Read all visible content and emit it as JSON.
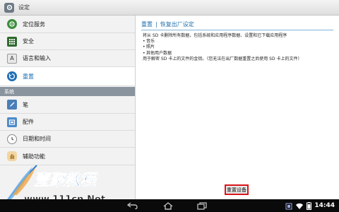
{
  "window": {
    "title": "设定"
  },
  "sidebar": {
    "items": [
      {
        "label": "定位服务",
        "icon": "location-icon",
        "color": "#3e8e3e"
      },
      {
        "label": "安全",
        "icon": "security-grid-icon",
        "color": "#2f6a2f"
      },
      {
        "label": "语言和输入",
        "icon": "language-icon",
        "color": "#6c6c6c"
      },
      {
        "label": "重置",
        "icon": "reset-icon",
        "color": "#1e6fb4",
        "selected": true
      },
      {
        "label": "笔",
        "icon": "pen-icon",
        "color": "#4a7fb8"
      },
      {
        "label": "配件",
        "icon": "accessory-icon",
        "color": "#4b8ac9"
      },
      {
        "label": "日期和时间",
        "icon": "clock-icon",
        "color": "#888888"
      },
      {
        "label": "辅助功能",
        "icon": "hand-icon",
        "color": "#d8a24a"
      }
    ],
    "section_header": "系统"
  },
  "content": {
    "breadcrumb": {
      "parent": "重置",
      "current": "恢复出厂设定"
    },
    "description": "将从 SD 卡删除所有数据，包括系统和应用程序数据、设置和已下载应用程序",
    "bullets": [
      "音乐",
      "照片",
      "其他用户数据"
    ],
    "note": "用于解密 SD 卡上的文件的金钥。（您无法在出厂数据重置之后使用 SD 卡上的文件）",
    "reset_button": "重置设备"
  },
  "watermark": {
    "text": "壹聚教程",
    "url": "www.111cn.Net"
  },
  "navbar": {
    "time": "14:44",
    "buttons": [
      "back-icon",
      "home-icon",
      "recent-apps-icon"
    ]
  },
  "colors": {
    "accent": "#1e6fb4",
    "section_header_bg": "#8a949e",
    "highlight_border": "#d9151c"
  }
}
